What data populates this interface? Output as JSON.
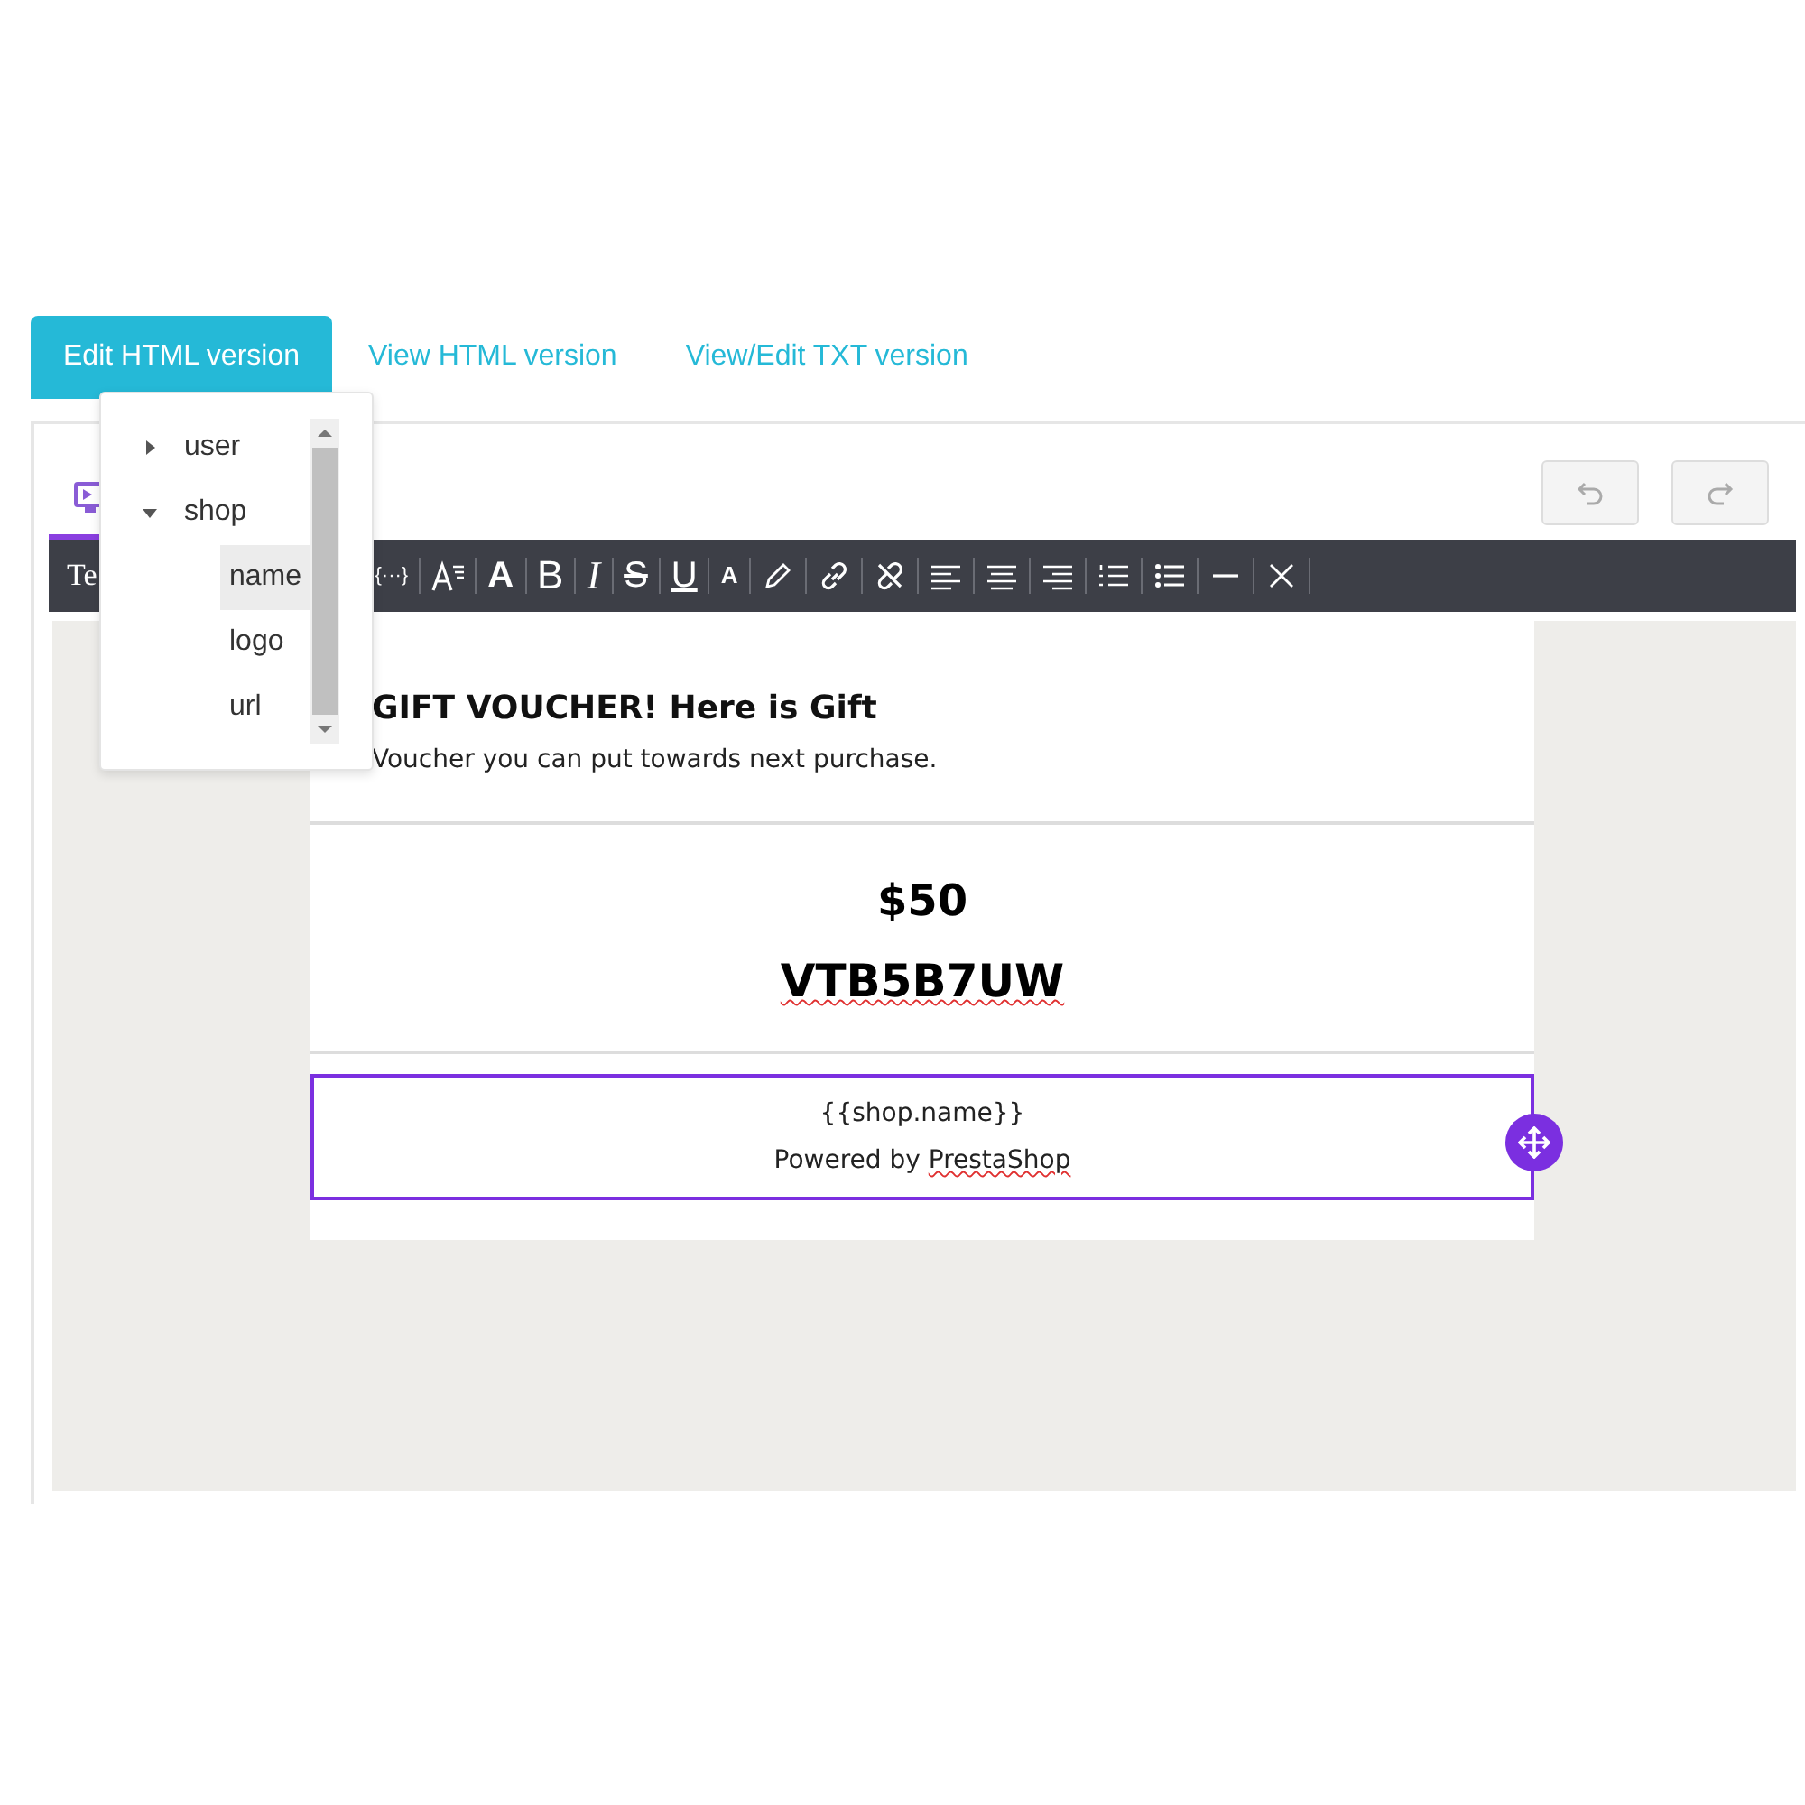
{
  "tabs": [
    {
      "label": "Edit HTML version",
      "selected": true
    },
    {
      "label": "View HTML version",
      "selected": false
    },
    {
      "label": "View/Edit TXT version",
      "selected": false
    }
  ],
  "editor": {
    "view_tabs": [
      {
        "selected": true
      }
    ],
    "history_buttons": [
      {
        "disabled": true
      },
      {
        "disabled": true
      }
    ],
    "toolbar": {
      "label": "Te",
      "items": [
        {
          "kind": "text",
          "label": "{···}"
        },
        {
          "kind": "icon"
        },
        {
          "kind": "text",
          "label": "A"
        },
        {
          "kind": "text",
          "label": "B"
        },
        {
          "kind": "text",
          "label": "I"
        },
        {
          "kind": "text",
          "label": "S"
        },
        {
          "kind": "text",
          "label": "U"
        },
        {
          "kind": "text",
          "label": "A"
        },
        {
          "kind": "icon"
        },
        {
          "kind": "icon"
        },
        {
          "kind": "icon"
        },
        {
          "kind": "icon"
        },
        {
          "kind": "icon"
        },
        {
          "kind": "icon"
        },
        {
          "kind": "icon"
        },
        {
          "kind": "icon"
        },
        {
          "kind": "icon"
        },
        {
          "kind": "icon"
        }
      ]
    },
    "email": {
      "heading": "GIFT VOUCHER! Here is Gift",
      "intro": "Voucher you can put towards next purchase.",
      "amount": "$50",
      "code": "VTB5B7UW",
      "footer": {
        "selected": true,
        "variable": "{{shop.name}}",
        "powered_prefix": "Powered by ",
        "powered_link": "PrestaShop"
      }
    }
  },
  "variables_menu": {
    "items": [
      {
        "label": "user",
        "expanded": false
      },
      {
        "label": "shop",
        "expanded": true,
        "children": [
          {
            "label": "name",
            "selected": true
          },
          {
            "label": "logo",
            "selected": false
          },
          {
            "label": "url",
            "selected": false
          }
        ]
      }
    ]
  }
}
